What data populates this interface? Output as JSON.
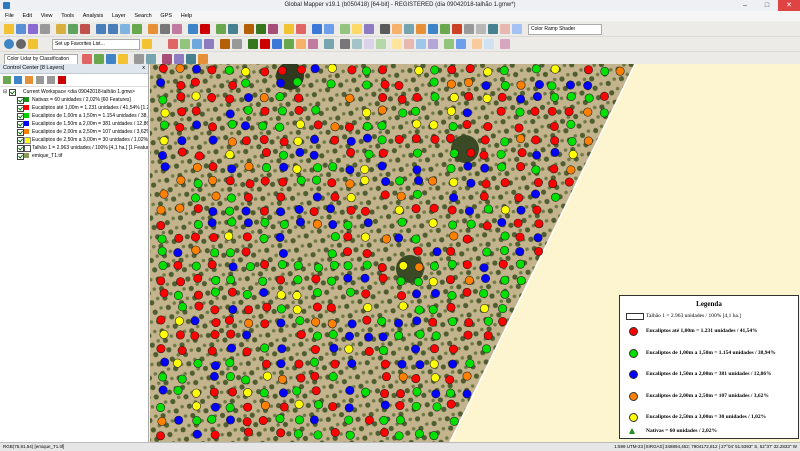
{
  "window": {
    "title": "Global Mapper v19.1 (b050418) [64-bit] - REGISTERED (dia 09042018-talhão 1.gmw*)"
  },
  "menu": [
    "File",
    "Edit",
    "View",
    "Tools",
    "Analysis",
    "Layer",
    "Search",
    "GPS",
    "Help"
  ],
  "toolbar": {
    "color_ramp": "Color Ramp Shader",
    "favorites": "Set up Favorites List...",
    "lidar": "Color Lidar by Classification"
  },
  "control_center": {
    "title": "Control Center [8 Layers]",
    "close": "x",
    "layers": [
      {
        "label": "Current Workspace <dia 09042018-talhão 1.gmw>"
      },
      {
        "label": "Nativas = 60 unidades / 2,02% [60 Features]"
      },
      {
        "label": "Eucaliptos até 1,00m = 1.231 unidades / 41,54% [1.23"
      },
      {
        "label": "Eucaliptos de 1,00m a 1,50m = 1.154 unidades / 38,9"
      },
      {
        "label": "Eucaliptos de 1,50m a 2,00m = 381 unidades / 12,86%"
      },
      {
        "label": "Eucaliptos de 2,00m a 2,50m = 107 unidades / 3,62%"
      },
      {
        "label": "Eucaliptos de 2,50m a 3,00m = 30 unidades / 1,02%"
      },
      {
        "label": "Talhão 1 = 2.963 unidades / 100% [4,1 ha.] [1 Featur"
      },
      {
        "label": "emique_T1.tif"
      }
    ]
  },
  "legend": {
    "title": "Legenda",
    "items": [
      {
        "text": "Talhão 1 = 2.963 unidades / 100% [4,1 ha.]",
        "symbol": "rect",
        "color": "#ffffff"
      },
      {
        "text": "Eucaliptos até 1,00m = 1.231 unidades / 41,54%",
        "symbol": "dot",
        "color": "#ff0000"
      },
      {
        "text": "Eucaliptos de 1,00m a 1,50m = 1.154 unidades / 38,94%",
        "symbol": "dot",
        "color": "#00e000"
      },
      {
        "text": "Eucaliptos de 1,50m a 2,00m = 381 unidades / 12,86%",
        "symbol": "dot",
        "color": "#0000ff"
      },
      {
        "text": "Eucaliptos de 2,00m a 2,50m = 107 unidades / 3,62%",
        "symbol": "dot",
        "color": "#ff8000"
      },
      {
        "text": "Eucaliptos de 2,50m a 3,00m = 30 unidades / 1,02%",
        "symbol": "dot",
        "color": "#ffff00"
      },
      {
        "text": "Nativas = 60 unidades / 2,02%",
        "symbol": "triangle",
        "color": "#1e8e1e"
      }
    ]
  },
  "status": {
    "left": "RGB(75,91,54) [emique_T1.tif]",
    "right": "1:599  UTM-23  [SIRGAS]  348894,452; 7904172,812  |  27°04' 51.5393\" S, 52°37' 32.2833\" W"
  }
}
